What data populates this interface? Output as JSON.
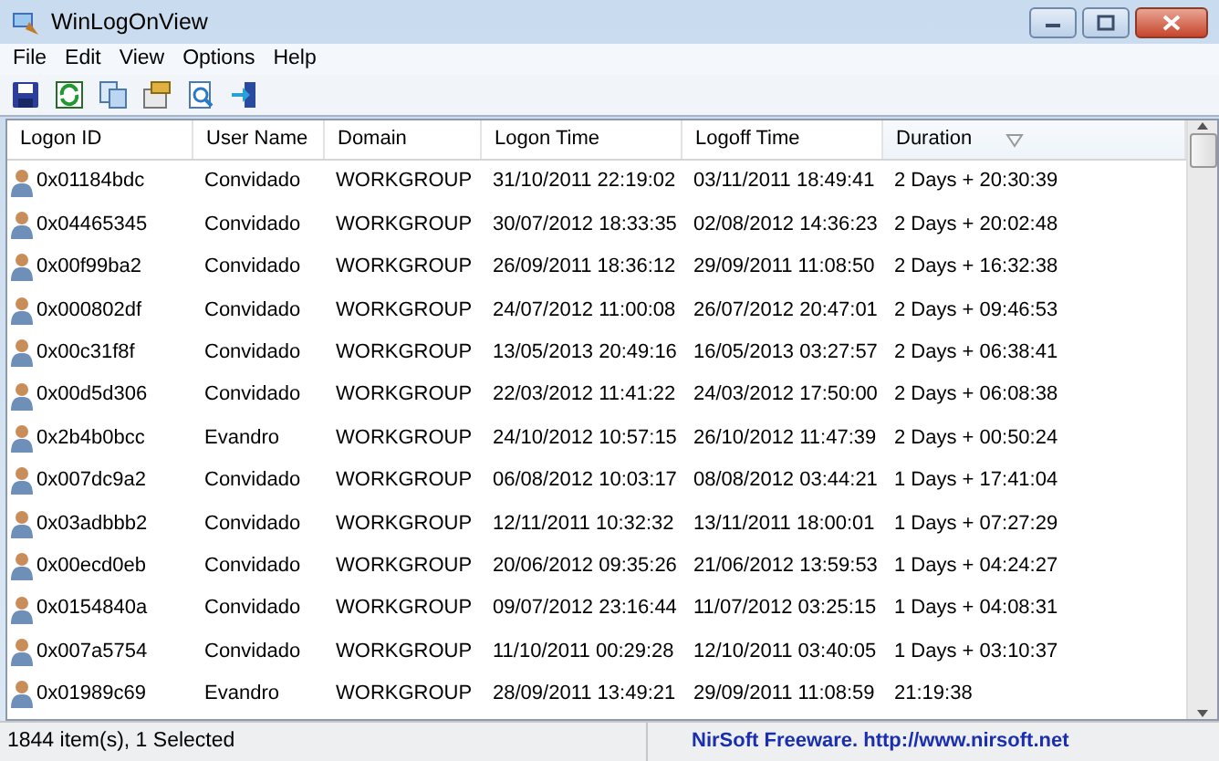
{
  "window": {
    "title": "WinLogOnView"
  },
  "menu": [
    "File",
    "Edit",
    "View",
    "Options",
    "Help"
  ],
  "toolbar": [
    {
      "kind": "save"
    },
    {
      "kind": "refresh"
    },
    {
      "kind": "copy"
    },
    {
      "kind": "properties"
    },
    {
      "kind": "report"
    },
    {
      "kind": "exit"
    }
  ],
  "table": {
    "columns": [
      {
        "label": "Logon ID",
        "sorted": false
      },
      {
        "label": "User Name",
        "sorted": false
      },
      {
        "label": "Domain",
        "sorted": false
      },
      {
        "label": "Logon Time",
        "sorted": false
      },
      {
        "label": "Logoff Time",
        "sorted": false
      },
      {
        "label": "Duration",
        "sorted": true
      }
    ],
    "rows": [
      [
        "0x01184bdc",
        "Convidado",
        "WORKGROUP",
        "31/10/2011 22:19:02",
        "03/11/2011 18:49:41",
        "2 Days + 20:30:39"
      ],
      [
        "0x04465345",
        "Convidado",
        "WORKGROUP",
        "30/07/2012 18:33:35",
        "02/08/2012 14:36:23",
        "2 Days + 20:02:48"
      ],
      [
        "0x00f99ba2",
        "Convidado",
        "WORKGROUP",
        "26/09/2011 18:36:12",
        "29/09/2011 11:08:50",
        "2 Days + 16:32:38"
      ],
      [
        "0x000802df",
        "Convidado",
        "WORKGROUP",
        "24/07/2012 11:00:08",
        "26/07/2012 20:47:01",
        "2 Days + 09:46:53"
      ],
      [
        "0x00c31f8f",
        "Convidado",
        "WORKGROUP",
        "13/05/2013 20:49:16",
        "16/05/2013 03:27:57",
        "2 Days + 06:38:41"
      ],
      [
        "0x00d5d306",
        "Convidado",
        "WORKGROUP",
        "22/03/2012 11:41:22",
        "24/03/2012 17:50:00",
        "2 Days + 06:08:38"
      ],
      [
        "0x2b4b0bcc",
        "Evandro",
        "WORKGROUP",
        "24/10/2012 10:57:15",
        "26/10/2012 11:47:39",
        "2 Days + 00:50:24"
      ],
      [
        "0x007dc9a2",
        "Convidado",
        "WORKGROUP",
        "06/08/2012 10:03:17",
        "08/08/2012 03:44:21",
        "1 Days + 17:41:04"
      ],
      [
        "0x03adbbb2",
        "Convidado",
        "WORKGROUP",
        "12/11/2011 10:32:32",
        "13/11/2011 18:00:01",
        "1 Days + 07:27:29"
      ],
      [
        "0x00ecd0eb",
        "Convidado",
        "WORKGROUP",
        "20/06/2012 09:35:26",
        "21/06/2012 13:59:53",
        "1 Days + 04:24:27"
      ],
      [
        "0x0154840a",
        "Convidado",
        "WORKGROUP",
        "09/07/2012 23:16:44",
        "11/07/2012 03:25:15",
        "1 Days + 04:08:31"
      ],
      [
        "0x007a5754",
        "Convidado",
        "WORKGROUP",
        "11/10/2011 00:29:28",
        "12/10/2011 03:40:05",
        "1 Days + 03:10:37"
      ],
      [
        "0x01989c69",
        "Evandro",
        "WORKGROUP",
        "28/09/2011 13:49:21",
        "29/09/2011 11:08:59",
        "21:19:38"
      ]
    ]
  },
  "status_bar": {
    "count": "1844 item(s), 1 Selected",
    "credit": "NirSoft Freeware.  http://www.nirsoft.net"
  }
}
